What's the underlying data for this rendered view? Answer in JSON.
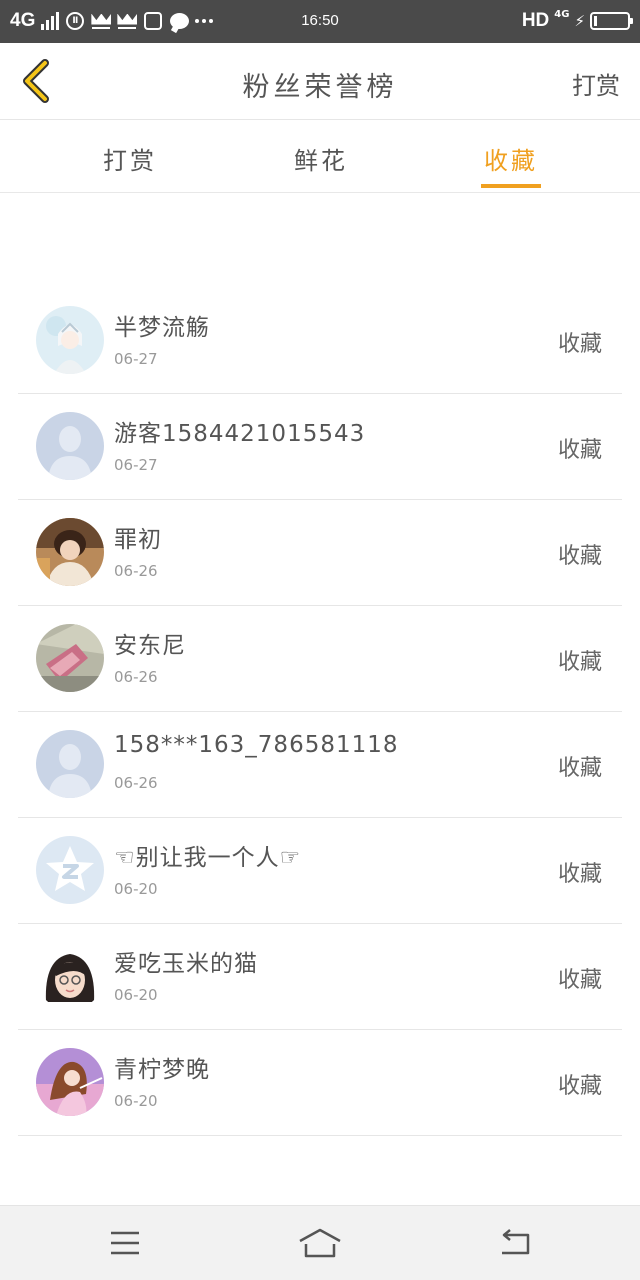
{
  "status_bar": {
    "network": "4G",
    "time": "16:50",
    "hd": "HD",
    "mobile_data": "4G"
  },
  "header": {
    "title": "粉丝荣誉榜",
    "action": "打赏"
  },
  "tabs": [
    {
      "label": "打赏",
      "active": false
    },
    {
      "label": "鲜花",
      "active": false
    },
    {
      "label": "收藏",
      "active": true
    }
  ],
  "accent_color": "#f0a020",
  "list": [
    {
      "name": "半梦流觞",
      "date": "06-27",
      "action": "收藏",
      "avatar": "anime-boy-avatar"
    },
    {
      "name": "游客1584421015543",
      "date": "06-27",
      "action": "收藏",
      "avatar": "default-user-avatar"
    },
    {
      "name": "罪初",
      "date": "06-26",
      "action": "收藏",
      "avatar": "photo-girl-avatar"
    },
    {
      "name": "安东尼",
      "date": "06-26",
      "action": "收藏",
      "avatar": "photo-avatar"
    },
    {
      "name": "158***163_786581118",
      "date": "06-26",
      "action": "收藏",
      "avatar": "default-user-avatar"
    },
    {
      "name": "☜别让我一个人☞",
      "date": "06-20",
      "action": "收藏",
      "avatar": "qq-logo-avatar"
    },
    {
      "name": "爱吃玉米的猫",
      "date": "06-20",
      "action": "收藏",
      "avatar": "cartoon-girl-avatar"
    },
    {
      "name": "青柠梦晚",
      "date": "06-20",
      "action": "收藏",
      "avatar": "anime-girl-avatar"
    }
  ]
}
